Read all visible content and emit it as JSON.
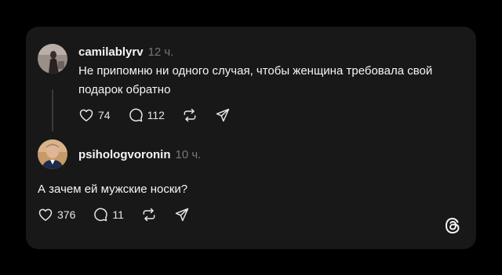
{
  "posts": [
    {
      "username": "camilablyrv",
      "time": "12 ч.",
      "text_line1": "Не припомню ни одного случая, чтобы женщина требовала свой",
      "text_line2": "подарок обратно",
      "likes": "74",
      "replies": "112",
      "avatar_colors": {
        "bg": "#9a8e88",
        "figure": "#2a2220"
      }
    },
    {
      "username": "psihologvoronin",
      "time": "10 ч.",
      "text_line1": "А зачем ей мужские носки?",
      "likes": "376",
      "replies": "11",
      "avatar_colors": {
        "bg": "#c79a6a",
        "figure": "#e0b796"
      }
    }
  ],
  "icons": {
    "like": "heart-icon",
    "reply": "comment-icon",
    "repost": "repost-icon",
    "share": "send-icon",
    "logo": "threads-logo-icon"
  },
  "colors": {
    "background": "#000000",
    "card": "#181818",
    "text": "#f3f5f7",
    "muted": "#777777"
  }
}
